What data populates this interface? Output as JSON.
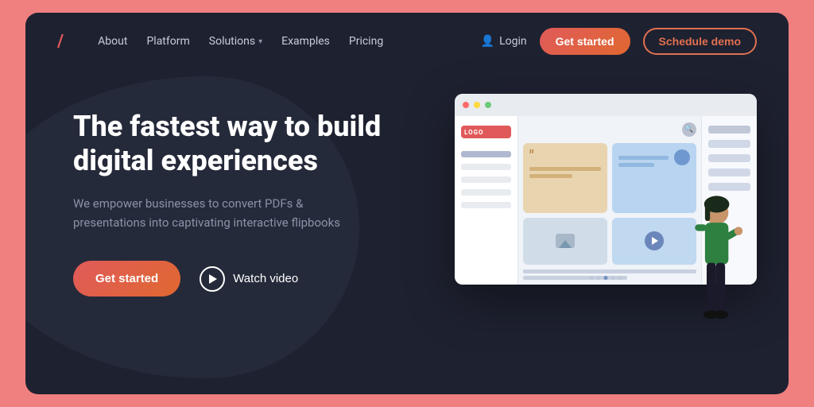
{
  "page": {
    "bg_color": "#f08080",
    "main_bg": "#1e2130"
  },
  "nav": {
    "logo": "/",
    "links": [
      {
        "label": "About",
        "id": "about"
      },
      {
        "label": "Platform",
        "id": "platform"
      },
      {
        "label": "Solutions",
        "id": "solutions",
        "has_dropdown": true
      },
      {
        "label": "Examples",
        "id": "examples"
      },
      {
        "label": "Pricing",
        "id": "pricing"
      }
    ],
    "login_label": "Login",
    "get_started_label": "Get started",
    "schedule_demo_label": "Schedule demo"
  },
  "hero": {
    "title": "The fastest way to build digital experiences",
    "subtitle": "We empower businesses to convert PDFs & presentations into captivating interactive flipbooks",
    "cta_primary": "Get started",
    "cta_secondary": "Watch video"
  },
  "browser_mockup": {
    "dots": [
      "red",
      "yellow",
      "green"
    ],
    "search_icon": "search-icon",
    "sidebar_items": 5,
    "indicator_dots": 5,
    "active_dot": 2
  }
}
